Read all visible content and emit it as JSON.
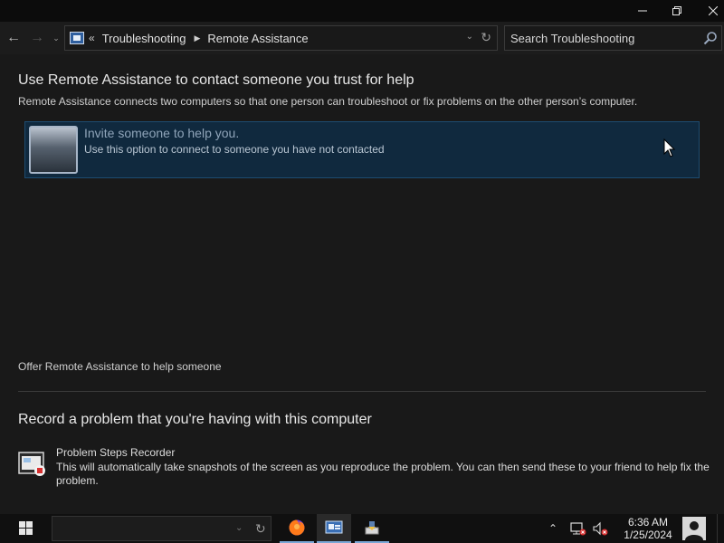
{
  "window": {
    "minimize_icon": "minimize-icon",
    "restore_icon": "restore-icon",
    "close_icon": "close-icon"
  },
  "address_bar": {
    "chevron": "«",
    "crumbs": [
      "Troubleshooting",
      "Remote Assistance"
    ],
    "search_placeholder": "Search Troubleshooting"
  },
  "main": {
    "heading": "Use Remote Assistance to contact someone you trust for help",
    "description": "Remote Assistance connects two computers so that one person can troubleshoot or fix problems on the other person’s computer.",
    "invite_title": "Invite someone to help you.",
    "invite_subtitle": "Use this option to connect to someone you have not contacted",
    "offer_link": "Offer Remote Assistance to help someone",
    "record_heading": "Record a problem that you're having with this computer",
    "psr_title": "Problem Steps Recorder",
    "psr_description": "This will automatically take snapshots of the screen as you reproduce the problem. You can then send these to your friend to help fix the problem."
  },
  "taskbar": {
    "apps": [
      "firefox-icon",
      "control-panel-icon",
      "installer-icon"
    ],
    "time": "6:36 AM",
    "date": "1/25/2024"
  },
  "colors": {
    "accent": "#7aa7d6",
    "selection_bg": "#10293e",
    "background": "#191919"
  }
}
